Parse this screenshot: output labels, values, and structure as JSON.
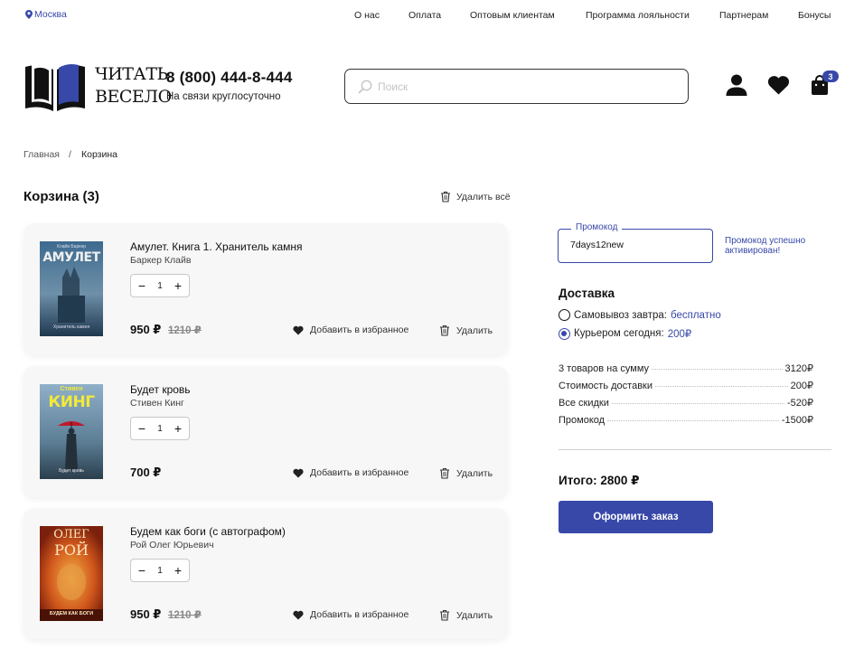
{
  "topbar": {
    "city": "Москва",
    "city_icon": "location-pin-icon",
    "nav": [
      "О нас",
      "Оплата",
      "Оптовым клиентам",
      "Программа лояльности",
      "Партнерам",
      "Бонусы"
    ]
  },
  "header": {
    "logo_line1": "ЧИТАТЬ",
    "logo_line2": "ВЕСЕЛО",
    "phone": "8 (800) 444-8-444",
    "phone_sub": "На связи круглосуточно",
    "search_placeholder": "Поиск",
    "cart_count": "3"
  },
  "breadcrumb": {
    "home": "Главная",
    "separator": "/",
    "current": "Корзина"
  },
  "cart": {
    "title": "Корзина (3)",
    "delete_all": "Удалить всё",
    "items": [
      {
        "title": "Амулет. Книга 1. Хранитель камня",
        "author": "Баркер Клайв",
        "qty": "1",
        "price": "950 ₽",
        "old_price": "1210 ₽",
        "fav_label": "Добавить в избранное",
        "remove_label": "Удалить",
        "cover_title": "АМУЛЕТ",
        "cover_top": "Клайв Баркер",
        "cover_bottom": "Хранитель камня"
      },
      {
        "title": "Будет кровь",
        "author": "Стивен Кинг",
        "qty": "1",
        "price": "700 ₽",
        "old_price": "",
        "fav_label": "Добавить в избранное",
        "remove_label": "Удалить",
        "cover_title": "КИНГ",
        "cover_top": "Стивен",
        "cover_bottom": "Будет кровь"
      },
      {
        "title": "Будем как боги (с автографом)",
        "author": "Рой Олег Юрьевич",
        "qty": "1",
        "price": "950 ₽",
        "old_price": "1210 ₽",
        "fav_label": "Добавить в избранное",
        "remove_label": "Удалить",
        "cover_title": "РОЙ",
        "cover_top": "ОЛЕГ",
        "cover_bottom": "БУДЕМ КАК БОГИ"
      }
    ]
  },
  "order": {
    "promo_label": "Промокод",
    "promo_value": "7days12new",
    "promo_status": "Промокод успешно активирован!",
    "delivery_title": "Доставка",
    "pickup_label": "Самовывоз завтра:",
    "pickup_value": "бесплатно",
    "courier_label": "Курьером сегодня:",
    "courier_value": "200₽",
    "summary": [
      {
        "label": "3 товаров на сумму",
        "value": "3120₽"
      },
      {
        "label": "Стоимость доставки",
        "value": "200₽"
      },
      {
        "label": "Все скидки",
        "value": "-520₽"
      },
      {
        "label": "Промокод",
        "value": "-1500₽"
      }
    ],
    "total": "Итого: 2800 ₽",
    "checkout_label": "Оформить заказ"
  },
  "colors": {
    "accent": "#3848a8",
    "card_bg": "#f7f7f7"
  }
}
